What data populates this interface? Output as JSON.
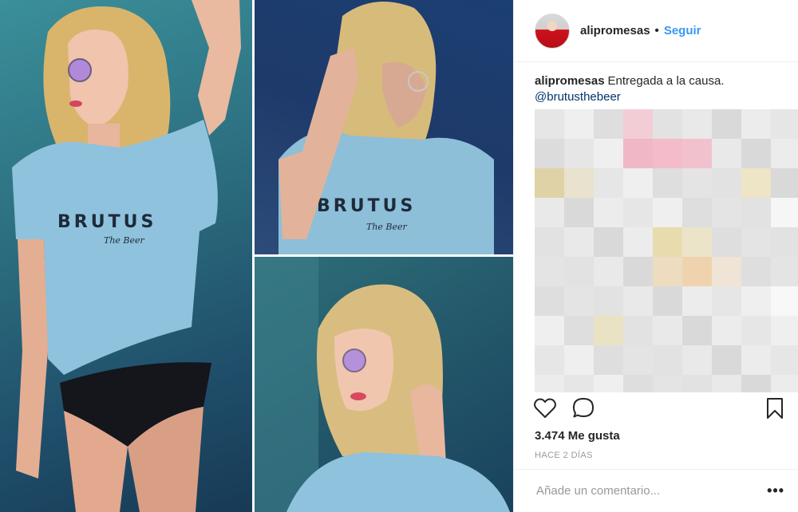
{
  "post": {
    "username": "alipromesas",
    "separator": "•",
    "follow_label": "Seguir",
    "caption_text": "Entregada a la causa.",
    "mention": "@brutusthebeer",
    "likes": "3.474 Me gusta",
    "time_ago": "HACE 2 DÍAS",
    "comment_placeholder": "Añade un comentario...",
    "more_label": "•••"
  },
  "photo": {
    "shirt_brand": "BRUTUS",
    "shirt_sub": "The Beer"
  },
  "icons": {
    "like": "heart-icon",
    "comment": "comment-icon",
    "save": "bookmark-icon",
    "more": "more-options-icon"
  },
  "colors": {
    "link_blue": "#3897f0",
    "mention_blue": "#003569",
    "muted": "#999999",
    "text": "#262626"
  }
}
